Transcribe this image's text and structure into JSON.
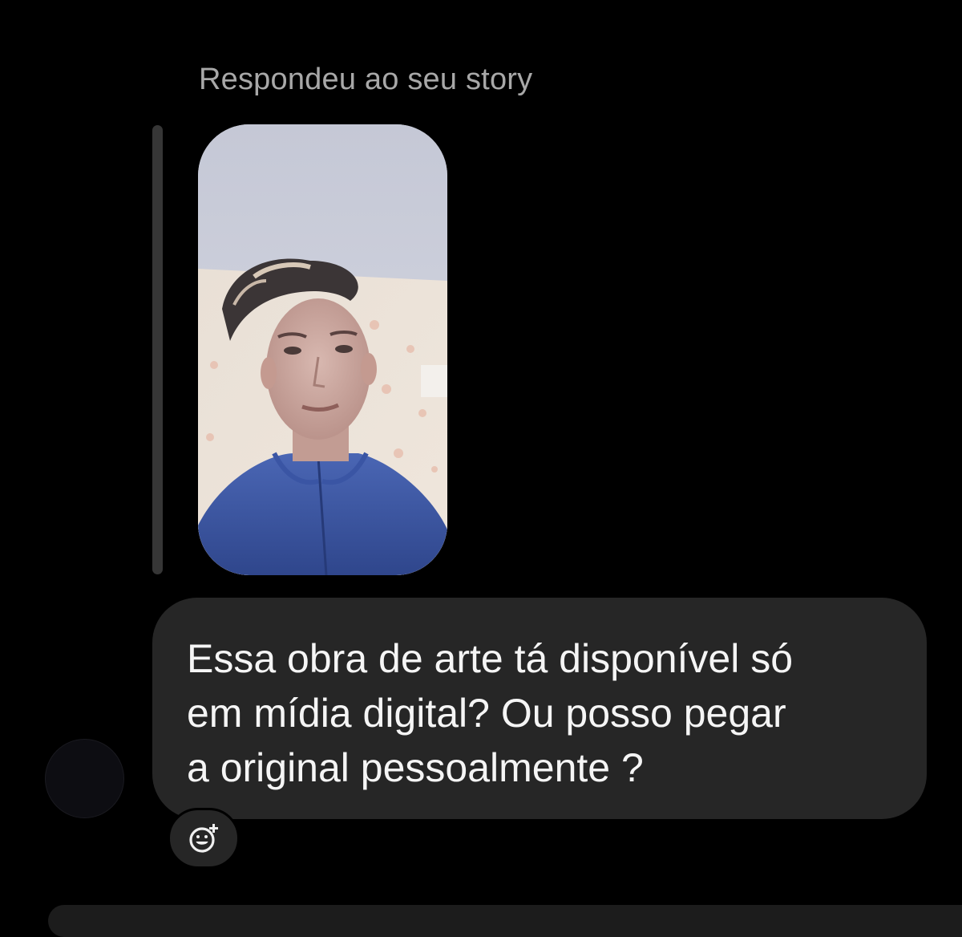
{
  "story_reply": {
    "label": "Respondeu ao seu story",
    "thumbnail_icon": "story-photo-thumbnail"
  },
  "message": {
    "lines": [
      "Essa obra de arte tá disponível só",
      "em mídia digital? Ou posso pegar",
      "a original pessoalmente ?"
    ]
  },
  "reaction": {
    "icon": "add-reaction-smiley-icon"
  },
  "colors": {
    "background": "#000000",
    "bubble": "#262626",
    "label_text": "#a8a8a8",
    "message_text": "#f5f5f5",
    "quote_bar": "#363636"
  }
}
